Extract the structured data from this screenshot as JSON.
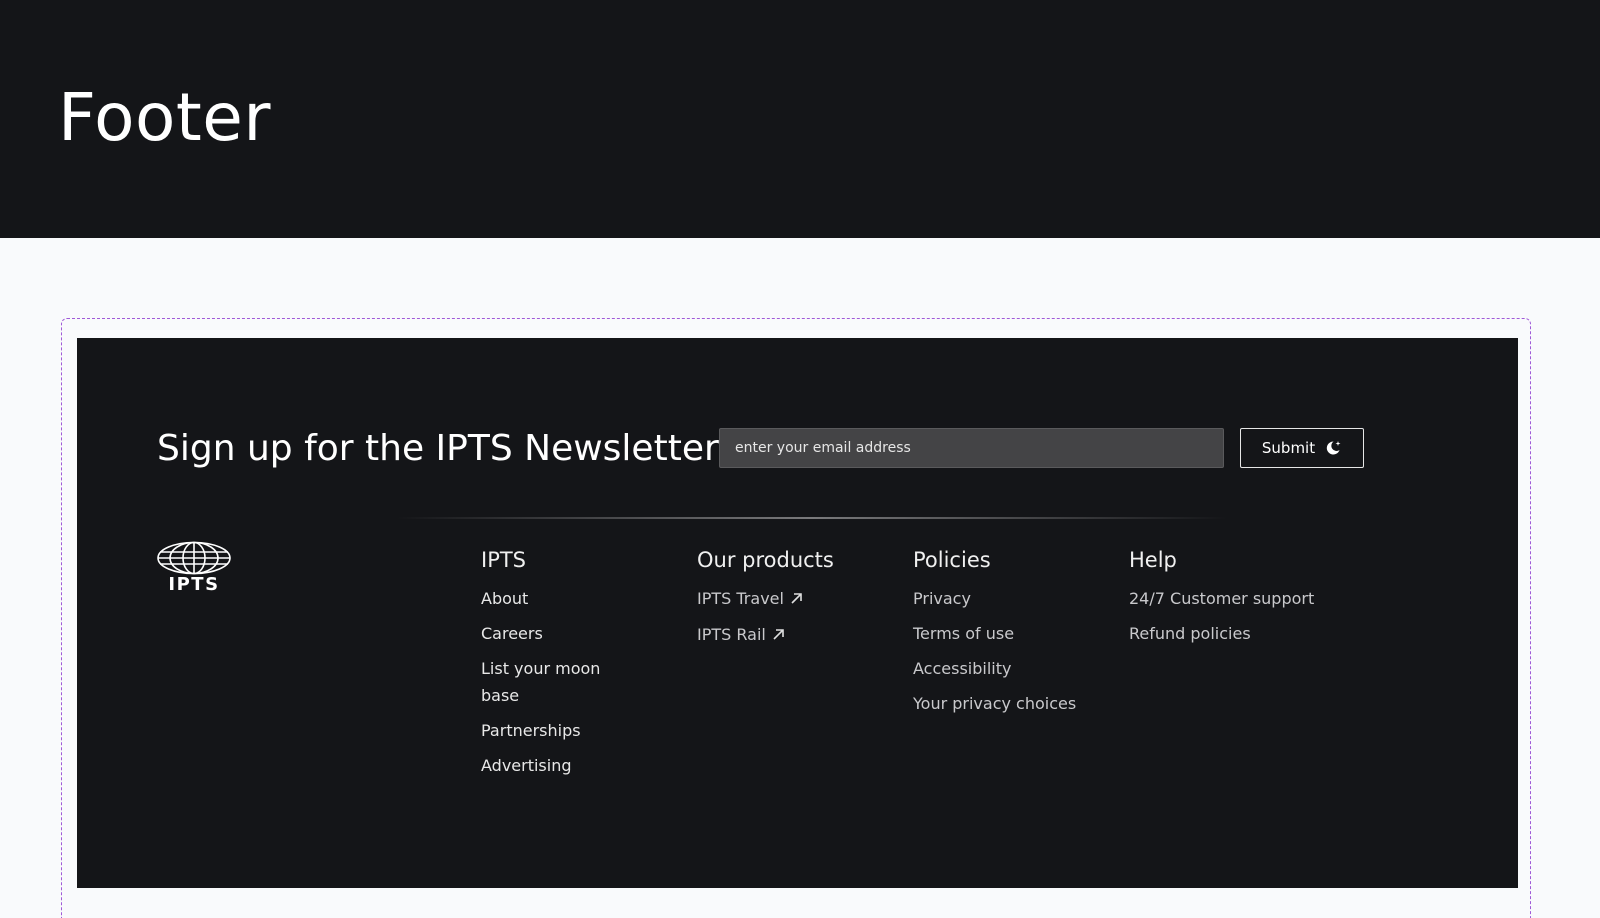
{
  "page": {
    "title": "Footer"
  },
  "newsletter": {
    "title": "Sign up for the IPTS Newsletter",
    "email_placeholder": "enter your email address",
    "submit_label": "Submit"
  },
  "logo": {
    "text": "IPTS",
    "icon": "globe-icon"
  },
  "columns": [
    {
      "heading": "IPTS",
      "links": [
        {
          "label": "About"
        },
        {
          "label": "Careers"
        },
        {
          "label": "List your moon base"
        },
        {
          "label": "Partnerships"
        },
        {
          "label": "Advertising"
        }
      ]
    },
    {
      "heading": "Our products",
      "links": [
        {
          "label": "IPTS Travel",
          "icon": "external-link-icon"
        },
        {
          "label": "IPTS Rail",
          "icon": "external-link-icon"
        }
      ]
    },
    {
      "heading": "Policies",
      "links": [
        {
          "label": "Privacy"
        },
        {
          "label": "Terms of use"
        },
        {
          "label": "Accessibility"
        },
        {
          "label": "Your privacy choices"
        }
      ]
    },
    {
      "heading": "Help",
      "links": [
        {
          "label": "24/7 Customer support"
        },
        {
          "label": "Refund policies"
        }
      ]
    }
  ],
  "colors": {
    "header_bg": "#141518",
    "page_bg": "#f9fafc",
    "footer_bg": "#141518",
    "frame_dash": "#a05ad8",
    "input_bg": "#444446"
  }
}
